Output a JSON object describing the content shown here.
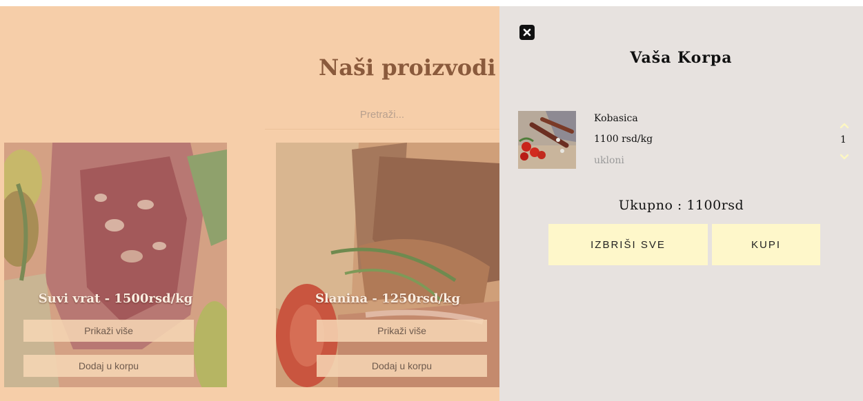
{
  "products_page": {
    "title": "Naši proizvodi",
    "search_placeholder": "Pretraži...",
    "cards": [
      {
        "caption": "Suvi vrat - 1500rsd/kg",
        "more_label": "Prikaži više",
        "add_label": "Dodaj u korpu"
      },
      {
        "caption": "Slanina - 1250rsd/kg",
        "more_label": "Prikaži više",
        "add_label": "Dodaj u korpu"
      }
    ]
  },
  "cart": {
    "close_icon": "close-icon",
    "title": "Vaša Korpa",
    "items": [
      {
        "name": "Kobasica",
        "price": "1100 rsd/kg",
        "remove_label": "ukloni",
        "quantity": "1"
      }
    ],
    "total": "Ukupno : 1100rsd",
    "clear_label": "IZBRIŠI SVE",
    "buy_label": "KUPI"
  },
  "colors": {
    "page_bg": "#f6cea9",
    "cart_bg": "#e7e2df",
    "button_bg": "#fef7ca",
    "title_color": "#8a5a3c"
  }
}
